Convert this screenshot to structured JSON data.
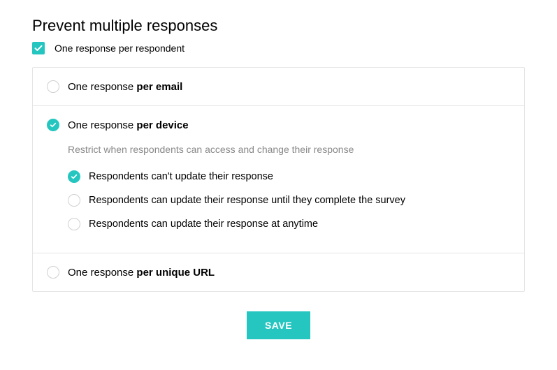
{
  "heading": "Prevent multiple responses",
  "master_checkbox": {
    "checked": true,
    "label": "One response per respondent"
  },
  "options": [
    {
      "id": "per-email",
      "prefix": "One response ",
      "bold": "per email",
      "selected": false
    },
    {
      "id": "per-device",
      "prefix": "One response ",
      "bold": "per device",
      "selected": true,
      "sub": {
        "description": "Restrict when respondents can access and change their response",
        "choices": [
          {
            "label": "Respondents can't update their response",
            "selected": true
          },
          {
            "label": "Respondents can update their response until they complete the survey",
            "selected": false
          },
          {
            "label": "Respondents can update their response at anytime",
            "selected": false
          }
        ]
      }
    },
    {
      "id": "per-url",
      "prefix": "One response ",
      "bold": "per unique URL",
      "selected": false
    }
  ],
  "save_label": "SAVE",
  "colors": {
    "accent": "#26c6c0"
  }
}
